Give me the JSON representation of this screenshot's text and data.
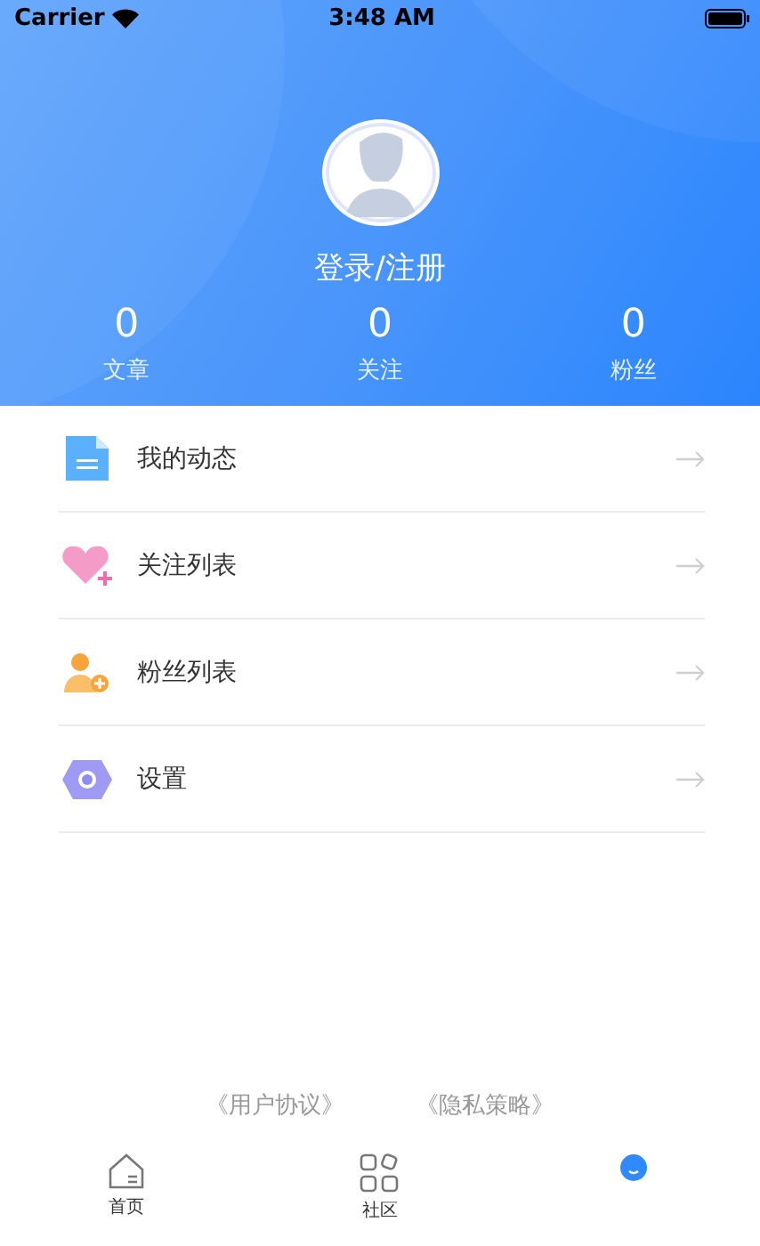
{
  "status_bar": {
    "carrier": "Carrier",
    "time": "3:48 AM"
  },
  "profile": {
    "login": "登录/注册",
    "stats": [
      {
        "value": "0",
        "label": "文章"
      },
      {
        "value": "0",
        "label": "关注"
      },
      {
        "value": "0",
        "label": "粉丝"
      }
    ]
  },
  "menu": [
    {
      "kind": "posts",
      "label": "我的动态"
    },
    {
      "kind": "follow",
      "label": "关注列表"
    },
    {
      "kind": "fans",
      "label": "粉丝列表"
    },
    {
      "kind": "settings",
      "label": "设置"
    }
  ],
  "links": [
    "《用户协议》",
    "《隐私策略》"
  ],
  "tabs": [
    {
      "kind": "home",
      "label": "首页",
      "selected": false
    },
    {
      "kind": "community",
      "label": "社区",
      "selected": false
    },
    {
      "kind": "me",
      "selected": true
    }
  ]
}
